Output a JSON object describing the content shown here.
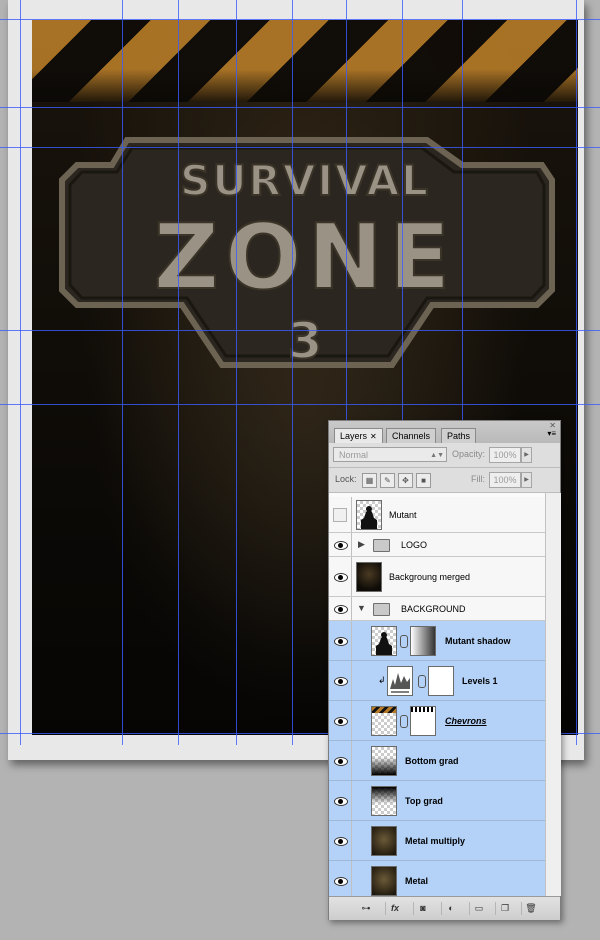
{
  "artwork": {
    "logo_line1": "SURVIVAL",
    "logo_line2": "ZONE",
    "logo_numeral": "3"
  },
  "layers_panel": {
    "tabs": [
      {
        "label": "Layers",
        "close": "✕",
        "active": true
      },
      {
        "label": "Channels",
        "active": false
      },
      {
        "label": "Paths",
        "active": false
      }
    ],
    "blend_mode": "Normal",
    "opacity_label": "Opacity:",
    "opacity_value": "100%",
    "lock_label": "Lock:",
    "fill_label": "Fill:",
    "fill_value": "100%",
    "layers": [
      {
        "name": "Mutant",
        "visible": false,
        "selected": false,
        "type": "layer",
        "thumb": "mutant-silhouette"
      },
      {
        "name": "LOGO",
        "visible": true,
        "selected": false,
        "type": "group",
        "expanded": false
      },
      {
        "name": "Backgroung merged",
        "visible": true,
        "selected": false,
        "type": "layer",
        "thumb": "dark-texture"
      },
      {
        "name": "BACKGROUND",
        "visible": true,
        "selected": false,
        "type": "group",
        "expanded": true
      },
      {
        "name": "Mutant shadow",
        "visible": true,
        "selected": true,
        "type": "layer",
        "thumb": "mutant-silhouette",
        "mask": "gradient"
      },
      {
        "name": "Levels 1",
        "visible": true,
        "selected": true,
        "type": "adjustment",
        "clipped": true,
        "thumb": "histogram",
        "mask": "white"
      },
      {
        "name": "Chevrons",
        "visible": true,
        "selected": true,
        "type": "layer",
        "thumb": "chevron-stripes",
        "mask": "white"
      },
      {
        "name": "Bottom grad",
        "visible": true,
        "selected": true,
        "type": "layer",
        "thumb": "bottom-gradient"
      },
      {
        "name": "Top grad",
        "visible": true,
        "selected": true,
        "type": "layer",
        "thumb": "top-gradient"
      },
      {
        "name": "Metal multiply",
        "visible": true,
        "selected": true,
        "type": "layer",
        "thumb": "metal-texture"
      },
      {
        "name": "Metal",
        "visible": true,
        "selected": true,
        "type": "layer",
        "thumb": "metal-texture"
      }
    ],
    "bottom_buttons": [
      "link-icon",
      "fx-icon",
      "mask-icon",
      "adjustment-icon",
      "folder-icon",
      "new-layer-icon",
      "trash-icon"
    ],
    "fx_label": "fx"
  },
  "colors": {
    "selection_blue": "#b4d2f7",
    "guide_blue": "#3a5cff",
    "stripe_orange": "#b47a28"
  }
}
